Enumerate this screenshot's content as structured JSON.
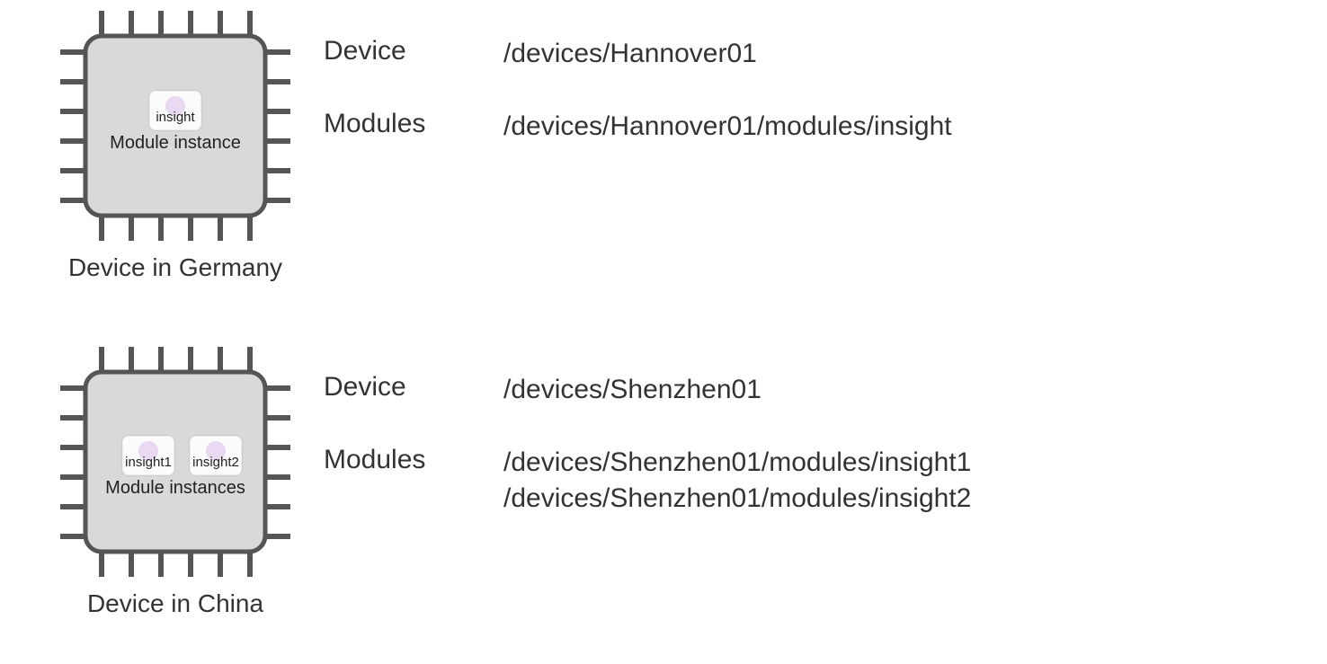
{
  "devices": [
    {
      "caption": "Device in Germany",
      "module_caption": "Module instance",
      "modules": [
        "insight"
      ],
      "info": {
        "device_label": "Device",
        "device_path": "/devices/Hannover01",
        "modules_label": "Modules",
        "module_paths": [
          "/devices/Hannover01/modules/insight"
        ]
      }
    },
    {
      "caption": "Device in China",
      "module_caption": "Module instances",
      "modules": [
        "insight1",
        "insight2"
      ],
      "info": {
        "device_label": "Device",
        "device_path": "/devices/Shenzhen01",
        "modules_label": "Modules",
        "module_paths": [
          "/devices/Shenzhen01/modules/insight1",
          "/devices/Shenzhen01/modules/insight2"
        ]
      }
    }
  ]
}
